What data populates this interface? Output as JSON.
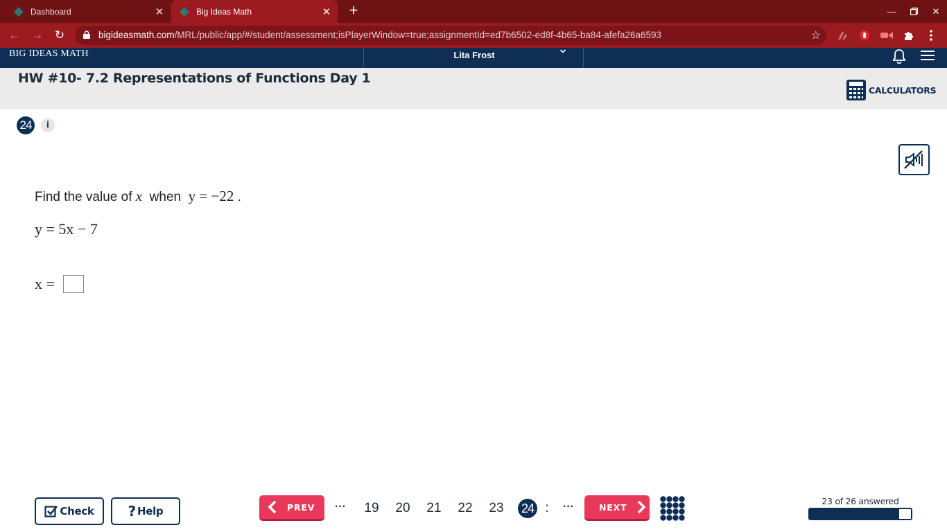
{
  "browser": {
    "tabs": [
      {
        "title": "Dashboard",
        "active": false
      },
      {
        "title": "Big Ideas Math",
        "active": true
      }
    ],
    "url_host": "bigideasmath.com",
    "url_path": "/MRL/public/app/#/student/assessment;isPlayerWindow=true;assignmentId=ed7b6502-ed8f-4b65-ba84-afefa26a6593"
  },
  "app": {
    "brand": "BIG IDEAS MATH",
    "user_name": "Lita Frost",
    "assignment_title": "HW #10- 7.2 Representations of Functions Day 1",
    "calculators_label": "CALCULATORS"
  },
  "question": {
    "number": "24",
    "info_label": "i",
    "prompt_prefix": "Find the value of",
    "prompt_var": "x",
    "prompt_when": "when",
    "prompt_condition": "y = −22",
    "prompt_suffix": ".",
    "equation": "y = 5x − 7",
    "answer_label": "x =",
    "answer_value": ""
  },
  "footer": {
    "check_label": "Check",
    "help_label": "Help",
    "prev_label": "PREV",
    "next_label": "NEXT",
    "ellipsis": "···",
    "pages": [
      "19",
      "20",
      "21",
      "22",
      "23",
      "24"
    ],
    "current_page": "24",
    "page_fragment": ":",
    "progress_label": "23 of 26 answered",
    "progress_fraction": 0.885
  },
  "colors": {
    "chrome_dark": "#6e1214",
    "chrome": "#9c1b21",
    "navy": "#0e2e54",
    "accent_red": "#e8395a"
  }
}
